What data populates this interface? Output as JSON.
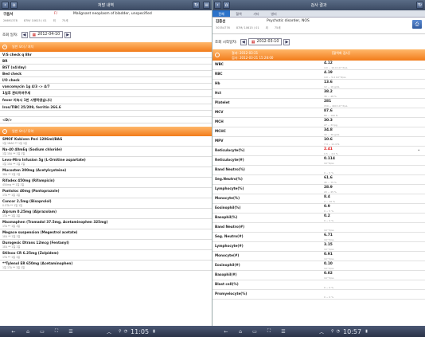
{
  "left": {
    "title": "처방 내역",
    "patient": {
      "name": "구음서",
      "sex": "F/",
      "diagnosis": "Malignant neoplasm of bladder, unspecified",
      "id": "26691378",
      "info": "87M/ 10615 / 01",
      "ward": "외",
      "dept": "75세"
    },
    "date_label": "조회 일자:",
    "date_value": "2012-04-10",
    "order_section": "일반 오더 / 처치",
    "orders": [
      "V/S check q 8hr",
      "BR",
      "BST (x4/day)",
      "Bed check",
      "I/O check",
      "vancomycin 1g  4/3 -> 4/7",
      "1일후 관리하여주세",
      "fever 지속시 1번 시행하였습니다",
      "   Iron/TIBC 25/209, ferritin 266.6",
      "",
      "<D/>"
    ],
    "drug_section": "일반 오더 / 투약",
    "drugs": [
      {
        "name": "SMOF Kabiven Peri 1206ml/BAG",
        "sub": "1일     1BAG ** 1일     1일"
      },
      {
        "name": "Na-40 40mEq (Sodium chloride)",
        "sub": "1일     1EA ** 1일     1일"
      },
      {
        "name": "Levo-Miro Infusion 5g (L-Ornitine aspartate)",
        "sub": "1일     1EA ** 1일     1일"
      },
      {
        "name": "Mucosten 300mg (Acetylcysteine)",
        "sub": "3EA ** 1일     1일"
      },
      {
        "name": "Rifadex 450mg (Rifampicin)",
        "sub": "450mg ** 1일     1일"
      },
      {
        "name": "Pantoloc 40mg (Pantoprazole)",
        "sub": "1TA ** 1일     1일"
      },
      {
        "name": "Concor 2.5mg (Bisoprolol)",
        "sub": "0.5TA ** 1일     1일"
      },
      {
        "name": "Alprum 0.25mg (Alprazolam)",
        "sub": "1TA ** 1일     1일"
      },
      {
        "name": "Maxmaphen (Tramadol 37.5mg, Acetaminophen 325mg)",
        "sub": "1TA ** 1일     1일"
      },
      {
        "name": "Megace suspension (Megestrol acetate)",
        "sub": "1EA ** 1일     1일"
      },
      {
        "name": "Durogesic Dtrans 12mcg (Fentanyl)",
        "sub": "1EA ** 1일     1일"
      },
      {
        "name": "Stilnox CR 6.25mg (Zolpidem)",
        "sub": "1TA ** 1일     1일"
      },
      {
        "name": "**Tylenol ER 650mg (Acetaminophen)",
        "sub": "1일     1TA ** 1일     1일"
      }
    ]
  },
  "right": {
    "title": "검사 결과",
    "tabs": [
      "전체",
      "혈액",
      "기타",
      "병리"
    ],
    "patient": {
      "name": "김종선",
      "sex": "",
      "diagnosis": "Psychotic disorder, NOS",
      "id": "30354776",
      "info": "87M/ 10615 / 01",
      "ward": "외",
      "dept": "75세"
    },
    "date_label": "조회 시작일자:",
    "date_value": "2012-03-10",
    "lab_head_line1": "결과: 2012-03-21",
    "lab_head_line2": "검사: 2012-03-21 15:28:00",
    "lab_head_tag": "[혈액화 검사]",
    "labs": [
      {
        "name": "WBC",
        "value": "4.12",
        "ref": "4.0 ~ 10.0 10^3/uL",
        "flag": false,
        "mark": ""
      },
      {
        "name": "RBC",
        "value": "4.19",
        "ref": "4.0 ~ 5.4 10^6/uL",
        "flag": false,
        "mark": ""
      },
      {
        "name": "Hb",
        "value": "13.6",
        "ref": "12 ~ 16 g/dL",
        "flag": false,
        "mark": ""
      },
      {
        "name": "Hct",
        "value": "38.2",
        "ref": "36 ~ 48 %",
        "flag": false,
        "mark": ""
      },
      {
        "name": "Platelet",
        "value": "281",
        "ref": "150 ~ 400 10^3/uL",
        "flag": false,
        "mark": ""
      },
      {
        "name": "MCV",
        "value": "87.6",
        "ref": "80 ~ 100 fL",
        "flag": false,
        "mark": ""
      },
      {
        "name": "MCH",
        "value": "30.3",
        "ref": "27 ~ 33 pg",
        "flag": false,
        "mark": ""
      },
      {
        "name": "MCHC",
        "value": "34.8",
        "ref": "32 ~ 36 g/dL",
        "flag": false,
        "mark": ""
      },
      {
        "name": "MPV",
        "value": "10.6",
        "ref": "7.4 ~ 11.4 fL",
        "flag": false,
        "mark": ""
      },
      {
        "name": "Reticulocyte(%)",
        "value": "2.41",
        "ref": "0.5 ~ 2.0 %",
        "flag": true,
        "mark": "•"
      },
      {
        "name": "Reticulocyte(#)",
        "value": "0.114",
        "ref": "10^6/uL",
        "flag": false,
        "mark": ""
      },
      {
        "name": "Band Neutro(%)",
        "value": "",
        "ref": "0 ~ 5 %",
        "flag": false,
        "mark": ""
      },
      {
        "name": "Seg.Neutro(%)",
        "value": "61.6",
        "ref": "45 ~ 75 %",
        "flag": false,
        "mark": ""
      },
      {
        "name": "Lymphocyte(%)",
        "value": "28.9",
        "ref": "20 ~ 45 %",
        "flag": false,
        "mark": ""
      },
      {
        "name": "Monocyte(%)",
        "value": "8.4",
        "ref": "2 ~ 10 %",
        "flag": false,
        "mark": ""
      },
      {
        "name": "Eosinophil(%)",
        "value": "0.9",
        "ref": "0 ~ 5 %",
        "flag": false,
        "mark": ""
      },
      {
        "name": "Basophil(%)",
        "value": "0.2",
        "ref": "0 ~ 2 %",
        "flag": false,
        "mark": ""
      },
      {
        "name": "Band Neutro(#)",
        "value": "",
        "ref": "10^3/uL",
        "flag": false,
        "mark": ""
      },
      {
        "name": "Seg. Neutro(#)",
        "value": "6.71",
        "ref": "10^3/uL",
        "flag": false,
        "mark": ""
      },
      {
        "name": "Lymphocyte(#)",
        "value": "3.15",
        "ref": "10^3/uL",
        "flag": false,
        "mark": ""
      },
      {
        "name": "Monocyte(#)",
        "value": "0.91",
        "ref": "10^3/uL",
        "flag": false,
        "mark": ""
      },
      {
        "name": "Eosinophil(#)",
        "value": "0.10",
        "ref": "10^3/uL",
        "flag": false,
        "mark": ""
      },
      {
        "name": "Basophil(#)",
        "value": "0.02",
        "ref": "10^3/uL",
        "flag": false,
        "mark": ""
      },
      {
        "name": "Blast cell(%)",
        "value": "",
        "ref": "0 ~ 0 %",
        "flag": false,
        "mark": ""
      },
      {
        "name": "Promyelocyte(%)",
        "value": "",
        "ref": "0 ~ 0 %",
        "flag": false,
        "mark": ""
      }
    ]
  },
  "navbar": {
    "left_clock": "11:05",
    "right_clock": "10:57",
    "icons": [
      "back-icon",
      "home-icon",
      "recent-apps-icon",
      "screenshot-icon",
      "menu-icon",
      "chevron-up-icon",
      "usb-icon",
      "wifi-icon",
      "battery-icon"
    ]
  },
  "colors": {
    "accent_orange": "#f27c1a",
    "title_bar": "#3b4a63",
    "flag_red": "#d11",
    "tab_active": "#2b72c9"
  }
}
